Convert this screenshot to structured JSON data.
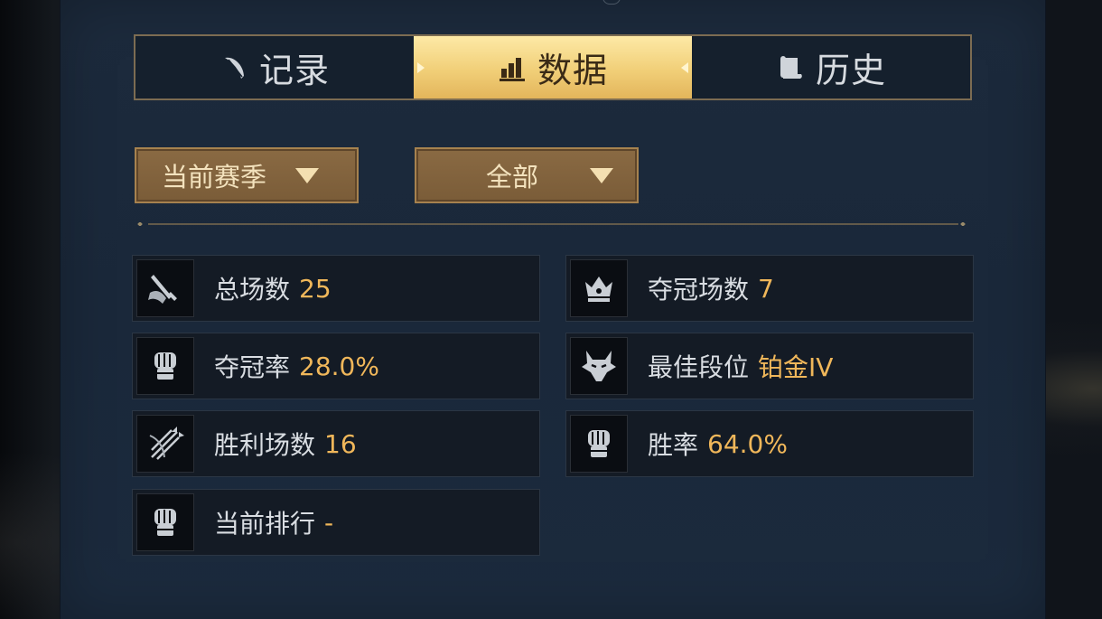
{
  "tabs": [
    {
      "label": "记录",
      "icon": "feather-icon",
      "active": false
    },
    {
      "label": "数据",
      "icon": "bar-chart-icon",
      "active": true
    },
    {
      "label": "历史",
      "icon": "scroll-icon",
      "active": false
    }
  ],
  "filters": {
    "season": {
      "selected": "当前赛季"
    },
    "mode": {
      "selected": "全部"
    }
  },
  "stats": [
    {
      "label": "总场数",
      "value": "25",
      "icon": "sword-scroll-icon"
    },
    {
      "label": "夺冠场数",
      "value": "7",
      "icon": "crown-icon"
    },
    {
      "label": "夺冠率",
      "value": "28.0%",
      "icon": "fist-icon"
    },
    {
      "label": "最佳段位",
      "value": "铂金IV",
      "icon": "wolf-icon"
    },
    {
      "label": "胜利场数",
      "value": "16",
      "icon": "arrows-icon"
    },
    {
      "label": "胜率",
      "value": "64.0%",
      "icon": "fist-icon"
    },
    {
      "label": "当前排行",
      "value": "-",
      "icon": "fist-icon"
    }
  ],
  "colors": {
    "panel": "#1c2a3c",
    "accent_gold": "#f0b75a",
    "tab_active": "#f1cf78",
    "dropdown": "#7a5c38"
  }
}
